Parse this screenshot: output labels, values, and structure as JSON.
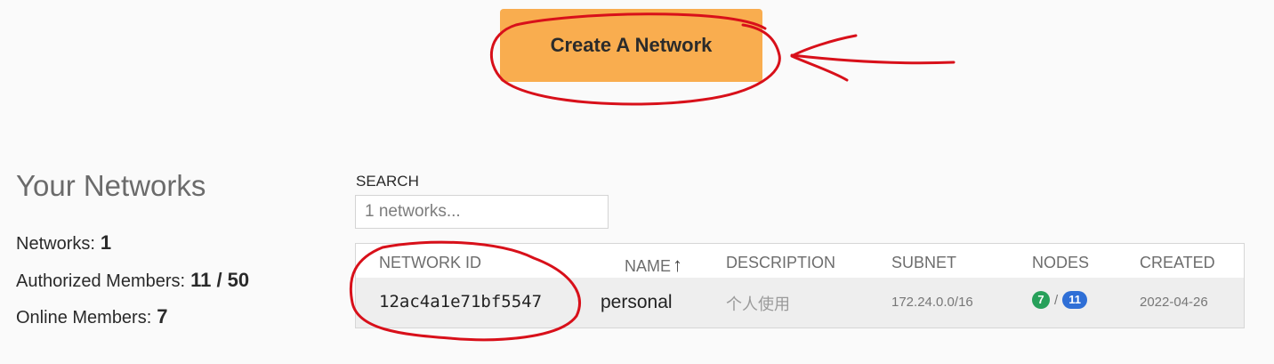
{
  "actions": {
    "create_network_label": "Create A Network"
  },
  "title": "Your Networks",
  "stats": {
    "networks_label": "Networks:",
    "networks_value": "1",
    "authorized_label": "Authorized Members:",
    "authorized_value": "11 / 50",
    "online_label": "Online Members:",
    "online_value": "7"
  },
  "search": {
    "label": "SEARCH",
    "placeholder": "1 networks..."
  },
  "table": {
    "columns": [
      "NETWORK ID",
      "NAME",
      "DESCRIPTION",
      "SUBNET",
      "NODES",
      "CREATED"
    ],
    "sort_indicator": "↑",
    "rows": [
      {
        "network_id": "12ac4a1e71bf5547",
        "name": "personal",
        "description": "个人使用",
        "subnet": "172.24.0.0/16",
        "nodes_online": "7",
        "nodes_separator": "/",
        "nodes_total": "11",
        "created": "2022-04-26"
      }
    ]
  },
  "colors": {
    "button": "#f9ad4f",
    "annotation_red": "#d8101a",
    "badge_green": "#27a05a",
    "badge_blue": "#2f6fd6"
  }
}
